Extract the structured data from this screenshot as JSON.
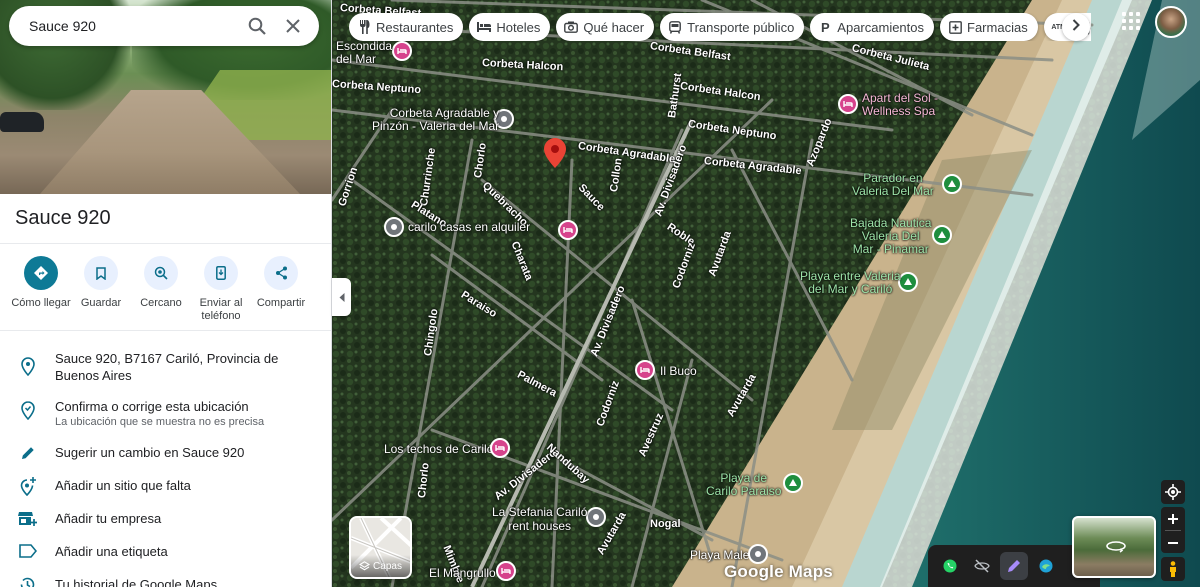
{
  "search": {
    "value": "Sauce 920"
  },
  "place": {
    "title": "Sauce 920"
  },
  "actions": [
    {
      "label": "Cómo llegar"
    },
    {
      "label": "Guardar"
    },
    {
      "label": "Cercano"
    },
    {
      "label": "Enviar al\nteléfono"
    },
    {
      "label": "Compartir"
    }
  ],
  "info": {
    "address": "Sauce 920, B7167 Cariló, Provincia de Buenos Aires",
    "confirm_title": "Confirma o corrige esta ubicación",
    "confirm_sub": "La ubicación que se muestra no es precisa",
    "suggest": "Sugerir un cambio en Sauce 920",
    "add_place": "Añadir un sitio que falta",
    "add_business": "Añadir tu empresa",
    "add_label": "Añadir una etiqueta",
    "history": "Tu historial de Google Maps"
  },
  "chips": [
    {
      "label": "Restaurantes",
      "icon": "restaurant-icon"
    },
    {
      "label": "Hoteles",
      "icon": "hotel-icon"
    },
    {
      "label": "Qué hacer",
      "icon": "camera-icon"
    },
    {
      "label": "Transporte público",
      "icon": "transit-icon"
    },
    {
      "label": "Aparcamientos",
      "icon": "parking-icon"
    },
    {
      "label": "Farmacias",
      "icon": "pharmacy-icon"
    },
    {
      "label": "Cajeros",
      "icon": "atm-icon"
    }
  ],
  "map": {
    "roads": {
      "corbeta_belfast": "Corbeta Belfast",
      "corbeta_halcon_1": "Corbeta Halcon",
      "corbeta_halcon_2": "Corbeta Halcon",
      "corbeta_julieta": "Corbeta Julieta",
      "corbeta_neptuno_1": "Corbeta Neptuno",
      "corbeta_neptuno_2": "Corbeta Neptuno",
      "corbeta_agradable_1": "Corbeta Agradable",
      "corbeta_agradable_2": "Corbeta Agradable",
      "bathurst": "Bathurst",
      "azopardo": "Azopardo",
      "chorlo": "Chorlo",
      "churrinche": "Churrinche",
      "quebracho": "Quebracho",
      "sauce": "Sauce",
      "collon": "Collon",
      "gorrion": "Gorrion",
      "platano": "Platano",
      "av_divisadero_1": "Av. Divisadero",
      "av_divisadero_2": "Av. Divisadero",
      "av_divisadero_3": "Av. Divisadero",
      "roble": "Roble",
      "cordoniz_1": "Codorniz",
      "cordoniz_2": "Codorniz",
      "charata": "Charata",
      "paraiso": "Paraiso",
      "chingolo": "Chingolo",
      "palmera": "Palmera",
      "avutarda_1": "Avutarda",
      "avutarda_2": "Avutarda",
      "avestruz": "Avestruz",
      "nandubay": "Nandubay",
      "chorlo2": "Chorlo",
      "mimbre": "Mimbre",
      "nogal": "Nogal"
    },
    "pois": {
      "escondida": "Escondida\ndel Mar",
      "corbeta_agradable_pinzon": "Corbeta Agradable y\nPinzón - Valeria del Mar",
      "apart_del_sol": "Apart del Sol -\nWellness Spa",
      "parador": "Parador en\nValeria Del Mar",
      "bajada_nautica": "Bajada Nautica\nValeria Del\nMar - Pinamar",
      "carilo_casas": "carilo casas en alquiler",
      "playa_entre": "Playa entre Valeria\ndel Mar y Cariló",
      "il_buco": "Il Buco",
      "los_techos": "Los techos de Cariló",
      "playa_carilo_paraiso": "Playa de\nCarilo Paraiso",
      "la_stefania": "La Stefania Cariló\nrent houses",
      "playa_male": "Playa Male",
      "el_mangrullo": "El Mangrullo",
      "corbeta_neptuno_partial": "Corbeta Neptuno"
    }
  },
  "layers": {
    "label": "Capas"
  },
  "logo": "Google Maps"
}
